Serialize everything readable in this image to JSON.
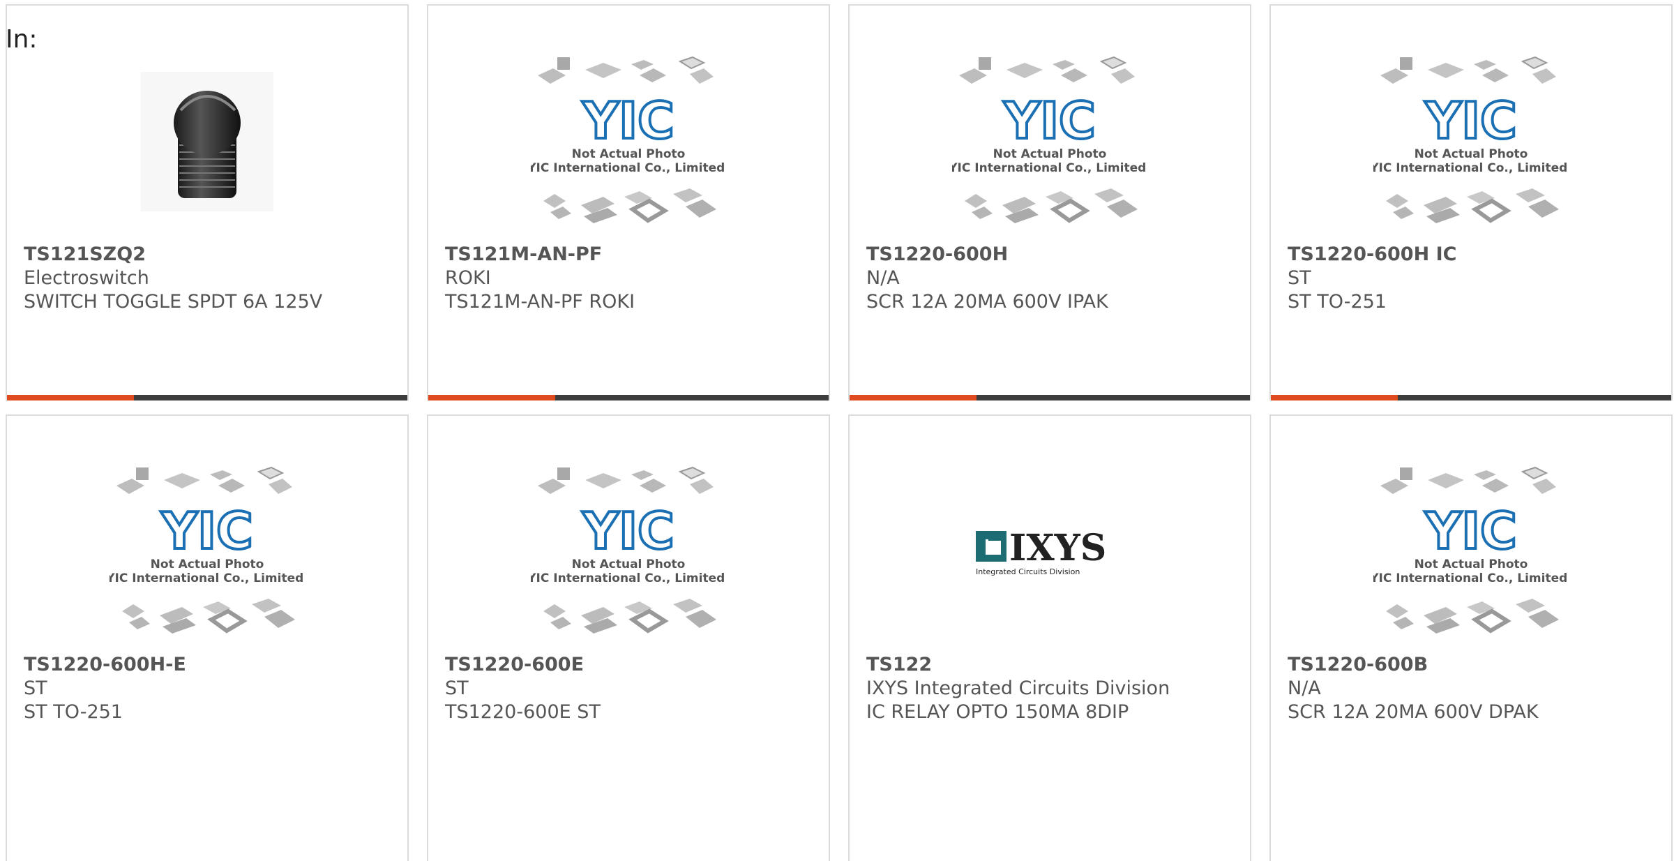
{
  "header": {
    "label": "In:"
  },
  "placeholder": {
    "line1": "Not Actual Photo",
    "line2": "YIC International Co., Limited.",
    "logo": "YIC"
  },
  "ixys_logo": {
    "name": "IXYS",
    "tagline": "Integrated Circuits Division"
  },
  "products": [
    {
      "part": "TS121SZQ2",
      "maker": "Electroswitch",
      "desc": "SWITCH TOGGLE SPDT 6A 125V",
      "image": "switch-photo"
    },
    {
      "part": "TS121M-AN-PF",
      "maker": "ROKI",
      "desc": "TS121M-AN-PF ROKI",
      "image": "yic-placeholder"
    },
    {
      "part": "TS1220-600H",
      "maker": "N/A",
      "desc": "SCR 12A 20MA 600V IPAK",
      "image": "yic-placeholder"
    },
    {
      "part": "TS1220-600H IC",
      "maker": "ST",
      "desc": "ST TO-251",
      "image": "yic-placeholder"
    },
    {
      "part": "TS1220-600H-E",
      "maker": "ST",
      "desc": "ST TO-251",
      "image": "yic-placeholder"
    },
    {
      "part": "TS1220-600E",
      "maker": "ST",
      "desc": "TS1220-600E ST",
      "image": "yic-placeholder"
    },
    {
      "part": "TS122",
      "maker": "IXYS Integrated Circuits Division",
      "desc": "IC RELAY OPTO 150MA 8DIP",
      "image": "ixys-logo"
    },
    {
      "part": "TS1220-600B",
      "maker": "N/A",
      "desc": "SCR 12A 20MA 600V DPAK",
      "image": "yic-placeholder"
    }
  ],
  "colors": {
    "accent": "#e04a1f",
    "bar": "#3d3d3d",
    "yic_blue": "#1b6fb3",
    "ixys_teal": "#1d6b73"
  }
}
